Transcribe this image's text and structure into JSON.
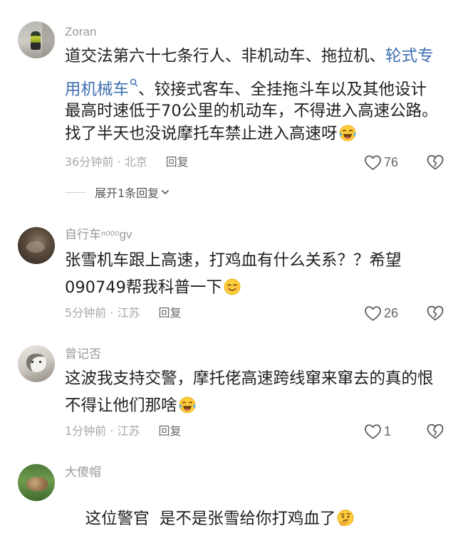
{
  "comments": [
    {
      "username": "Zoran",
      "line1_plain": "道交法第六十七条行人、非机动车、拖拉机、",
      "line1_link": "轮式专",
      "line2_link": "用机械车",
      "line2_plain": "、铰接式客车、全挂拖斗车以及其他设计",
      "line3": "最高时速低于70公里的机动车，不得进入高速公路。",
      "line4": "找了半天也没说摩托车禁止进入高速呀",
      "emoji": "face-with-tears-of-joy",
      "time_location": "36分钟前 · 北京",
      "reply": "回复",
      "likes": "76",
      "expand": "展开1条回复"
    },
    {
      "username": "自行车ⁿᵒᵒᵒgv",
      "line1": "张雪机车跟上高速，打鸡血有什么关系？？希望",
      "line2": "090749帮我科普一下",
      "emoji": "smiling-face",
      "time_location": "5分钟前 · 江苏",
      "reply": "回复",
      "likes": "26"
    },
    {
      "username": "曾记否",
      "line1": "这波我支持交警，摩托佬高速跨线窜来窜去的真的恨",
      "line2": "不得让他们那啥",
      "emoji": "face-with-tears-of-joy",
      "time_location": "1分钟前 · 江苏",
      "reply": "回复",
      "likes": "1"
    },
    {
      "username": "大傻帽",
      "line1": "这位警官  是不是张雪给你打鸡血了",
      "emoji": "thinking-face"
    }
  ],
  "colors": {
    "link": "#3e6eb0",
    "text": "#1f1f1f",
    "meta": "#a8a8a8",
    "username": "#9b9b9b"
  }
}
